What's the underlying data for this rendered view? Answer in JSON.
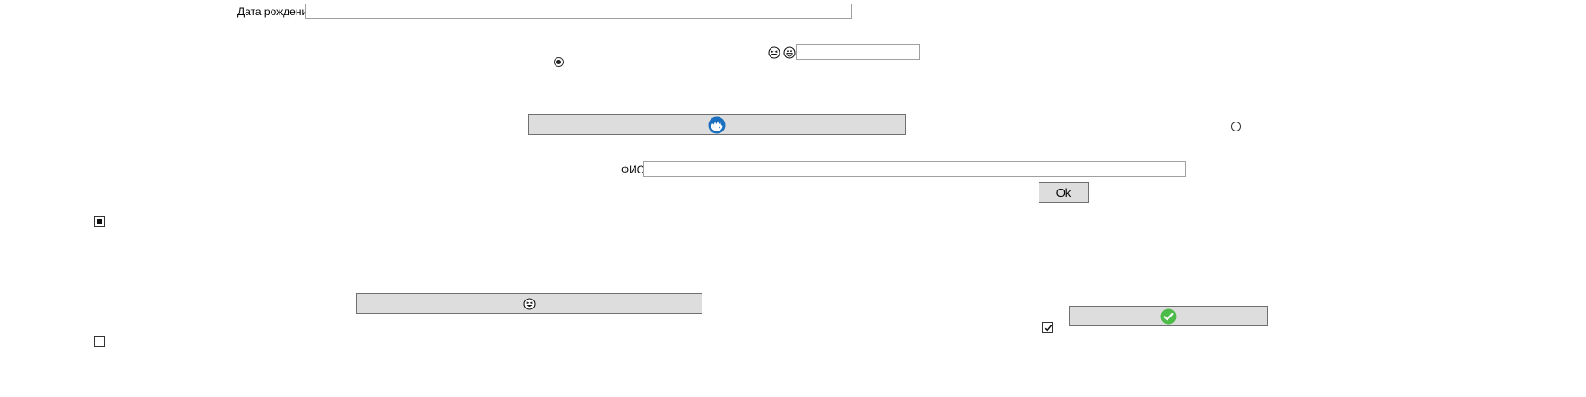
{
  "form": {
    "birthdate_label": "Дата рождения",
    "birthdate_value": "",
    "small_field_value": "",
    "fullname_label": "ФИО",
    "fullname_value": "",
    "ok_label": "Ok"
  },
  "controls": {
    "radio_1_checked": true,
    "radio_2_checked": false,
    "checkbox_1_state": "indeterminate",
    "checkbox_2_state": "checked",
    "checkbox_3_state": "unchecked"
  },
  "icons": {
    "laugh_icon": "grinning-squint-face-icon",
    "grin_icon": "grinning-face-icon",
    "blue_button_icon": "blue-emblem-icon",
    "emoji_button_icon": "grinning-squint-face-icon",
    "success_icon": "green-check-circle-icon"
  },
  "colors": {
    "button_bg": "#dddddd",
    "blue_icon": "#1a6fbf",
    "success_green": "#4cbb47"
  }
}
